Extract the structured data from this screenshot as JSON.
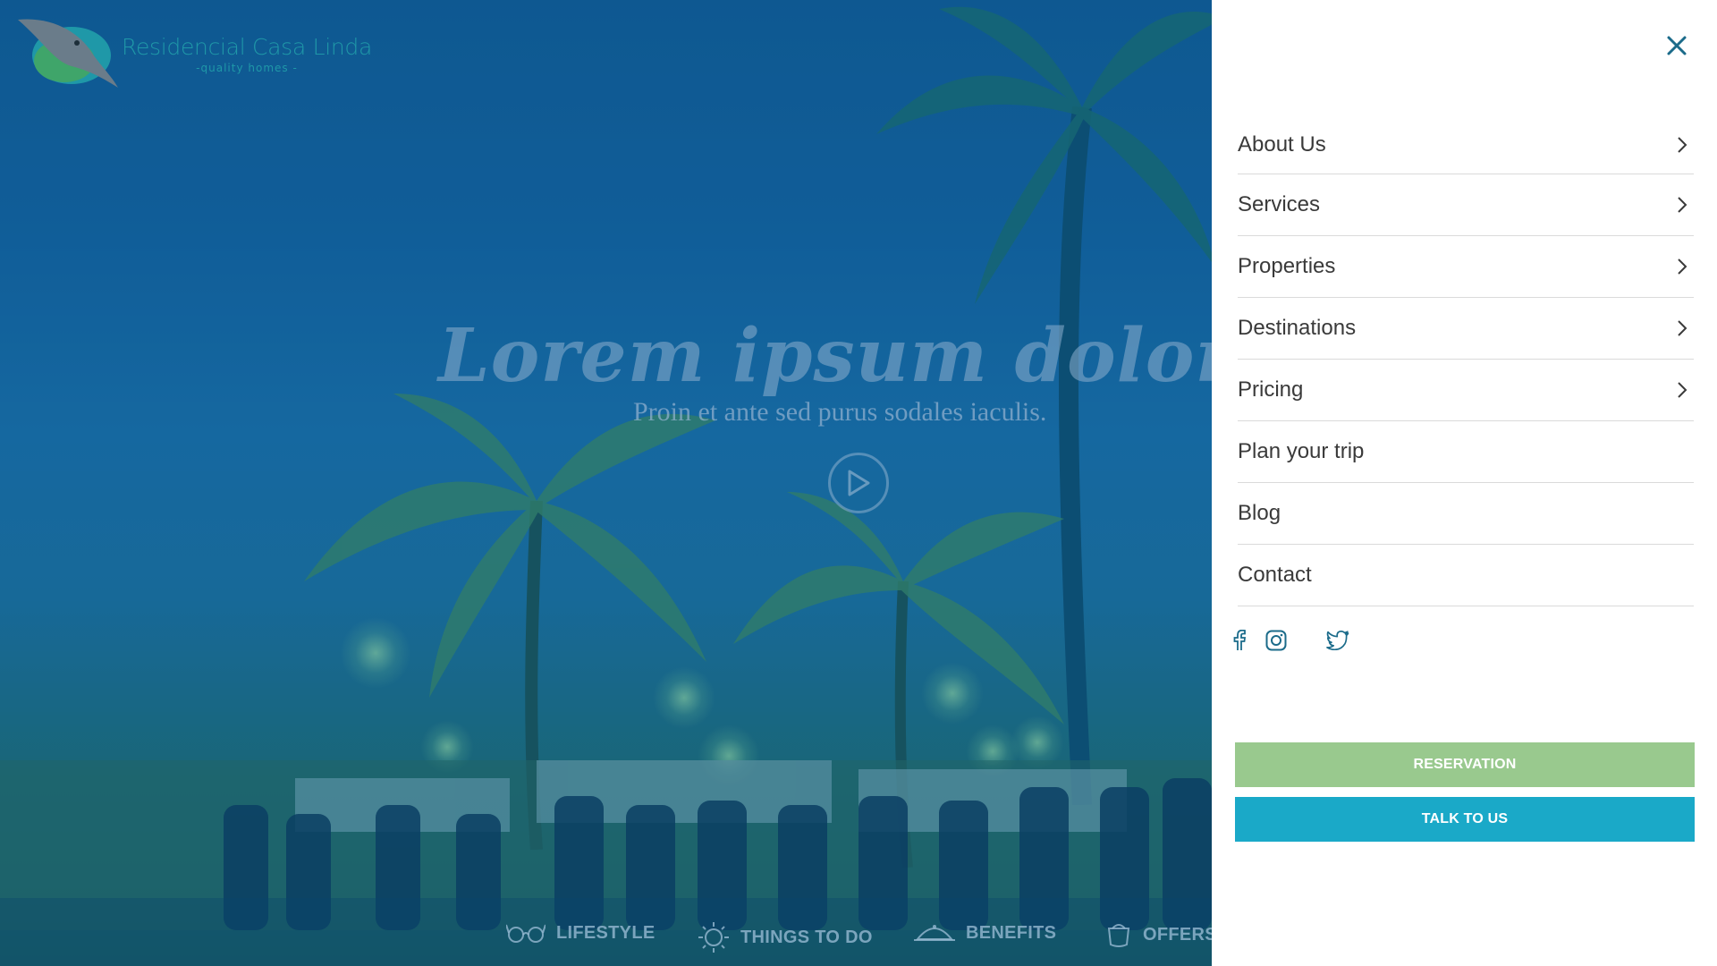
{
  "brand": {
    "name": "Residencial Casa Linda",
    "tagline": "-quality homes -",
    "color": "#1f98a8"
  },
  "hero": {
    "headline": "Lorem ipsum dolor sit amet",
    "subheadline": "Proin et ante sed purus sodales iaculis.",
    "play_icon": "play-circle-icon"
  },
  "bottom_nav": [
    {
      "label": "LIFESTYLE",
      "icon": "glasses-icon"
    },
    {
      "label": "THINGS TO DO",
      "icon": "sun-icon"
    },
    {
      "label": "BENEFITS",
      "icon": "dish-icon"
    },
    {
      "label": "OFFERS",
      "icon": "pot-icon"
    }
  ],
  "menu_panel": {
    "close_icon": "close-icon",
    "items": [
      {
        "label": "About Us",
        "has_arrow": true
      },
      {
        "label": "Services",
        "has_arrow": true
      },
      {
        "label": "Properties",
        "has_arrow": true
      },
      {
        "label": "Destinations",
        "has_arrow": true
      },
      {
        "label": "Pricing",
        "has_arrow": true
      },
      {
        "label": "Plan your trip",
        "has_arrow": false
      },
      {
        "label": "Blog",
        "has_arrow": false
      },
      {
        "label": "Contact",
        "has_arrow": false
      }
    ],
    "social": [
      "facebook-icon",
      "instagram-icon",
      "twitter-icon"
    ],
    "reservation_label": "RESERVATION",
    "talk_label": "TALK TO US",
    "colors": {
      "reservation": "#99c98e",
      "talk": "#1aa9c8",
      "icon": "#1b6b8a"
    }
  }
}
